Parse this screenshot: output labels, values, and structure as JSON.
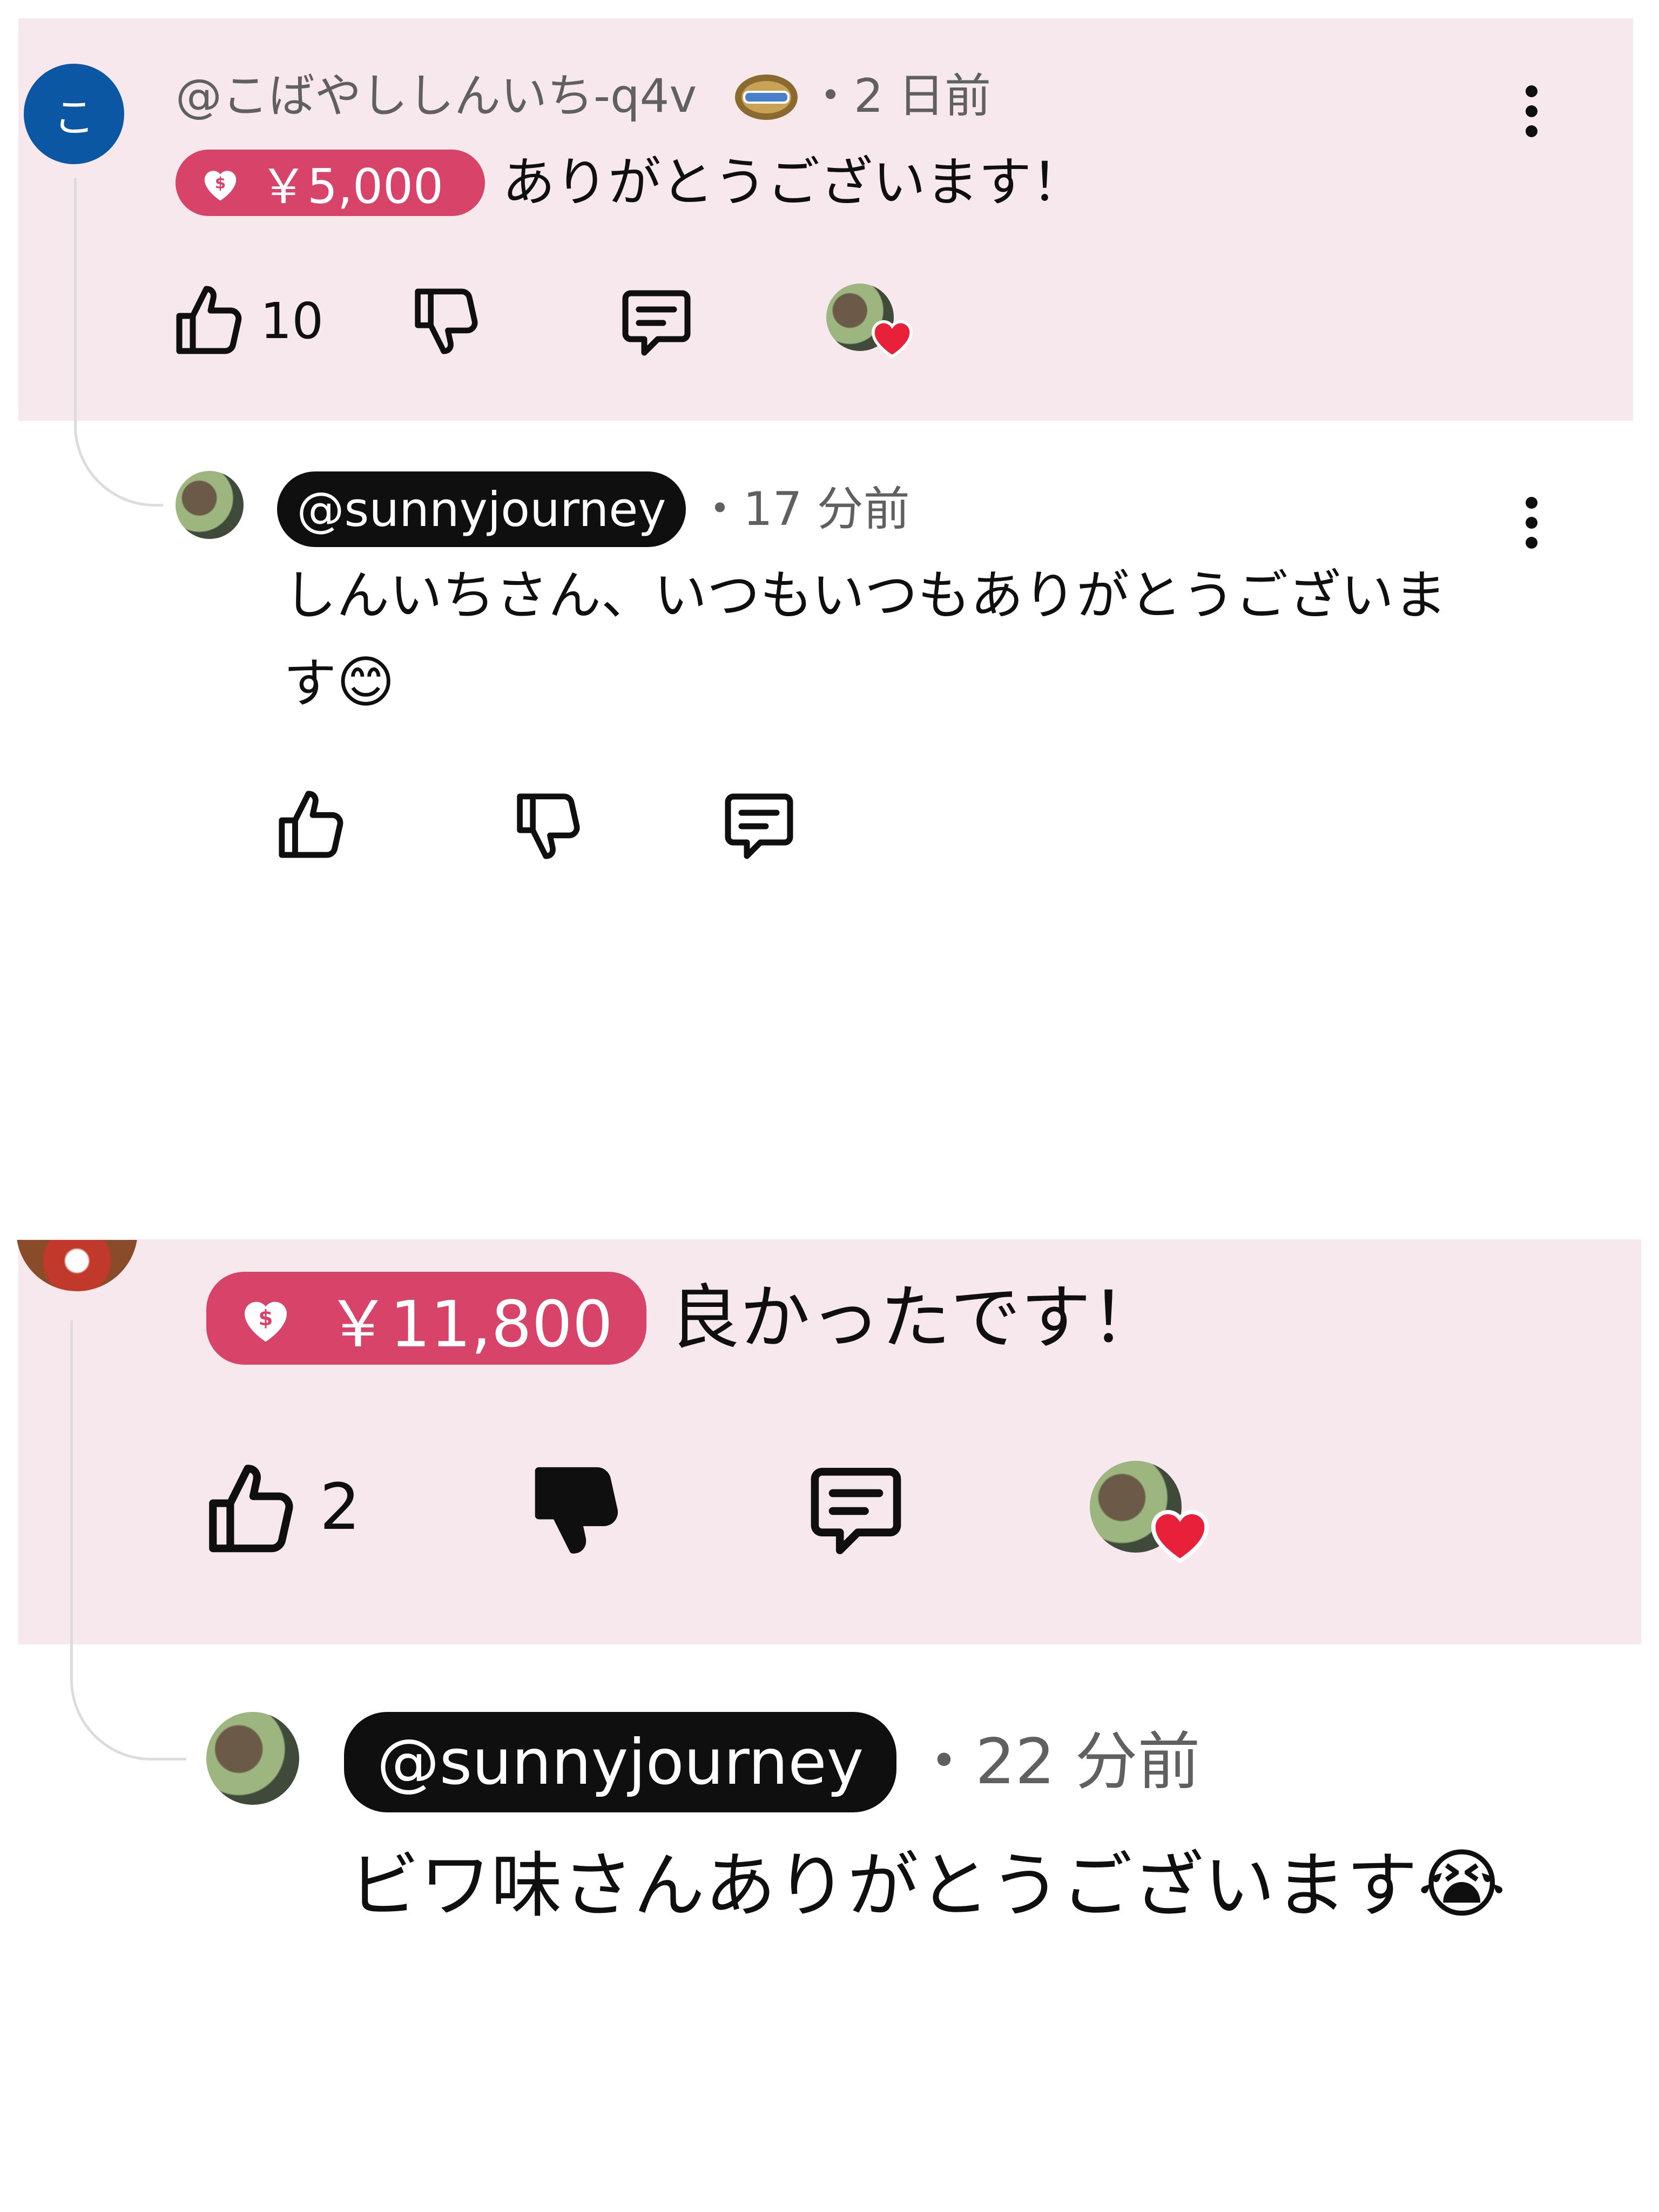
{
  "comment1": {
    "avatar_letter": "こ",
    "handle": "@こばやししんいち-q4v",
    "handle_icon": "member-badge-icon",
    "timestamp": "・2 日前",
    "super_thanks_amount": "￥5,000",
    "text": "ありがとうございます！",
    "like_count": "10"
  },
  "reply1": {
    "handle": "@sunnyjourney",
    "timestamp": "・17 分前",
    "text_line1": "しんいちさん、いつもいつもありがとうございま",
    "text_line2": "す",
    "emoji": "😊"
  },
  "comment2": {
    "super_thanks_amount": "￥11,800",
    "text": "良かったです！",
    "like_count": "2"
  },
  "reply2": {
    "handle": "@sunnyjourney",
    "timestamp": "・22 分前",
    "text": "ビワ味さんありがとうございます",
    "emoji": "😭"
  },
  "colors": {
    "super_thanks_pink": "#d8436a",
    "band_pink": "#f6e8ed",
    "avatar_blue": "#0b57a3",
    "heart_red": "#e8203a"
  }
}
